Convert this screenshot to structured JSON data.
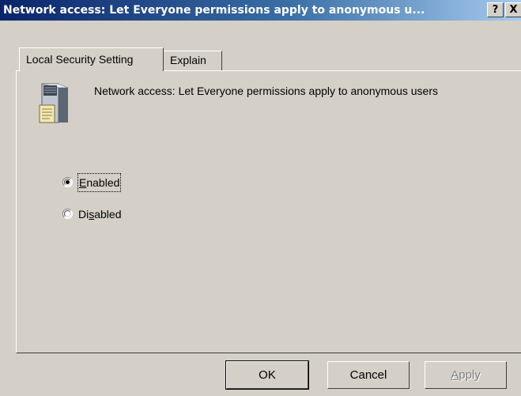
{
  "window": {
    "title": "Network access: Let Everyone permissions apply to anonymous u...",
    "help_button": "?",
    "close_button": "X"
  },
  "tabs": [
    {
      "label": "Local Security Setting",
      "selected": true
    },
    {
      "label": "Explain",
      "selected": false
    }
  ],
  "policy": {
    "icon": "server-icon",
    "description": "Network access: Let Everyone permissions apply to anonymous users"
  },
  "options": {
    "enabled": {
      "label": "Enabled",
      "accel": "E",
      "rest": "nabled",
      "checked": true,
      "focused": true
    },
    "disabled": {
      "label": "Disabled",
      "pre": "Di",
      "accel": "s",
      "rest": "abled",
      "checked": false
    }
  },
  "buttons": {
    "ok": {
      "label": "OK",
      "default": true
    },
    "cancel": {
      "label": "Cancel"
    },
    "apply": {
      "accel": "A",
      "rest": "pply",
      "label": "Apply",
      "disabled": true
    }
  },
  "colors": {
    "face": "#d4d0c8",
    "title_start": "#0a246a",
    "title_end": "#a6caf0",
    "disabled_text": "#808080"
  }
}
